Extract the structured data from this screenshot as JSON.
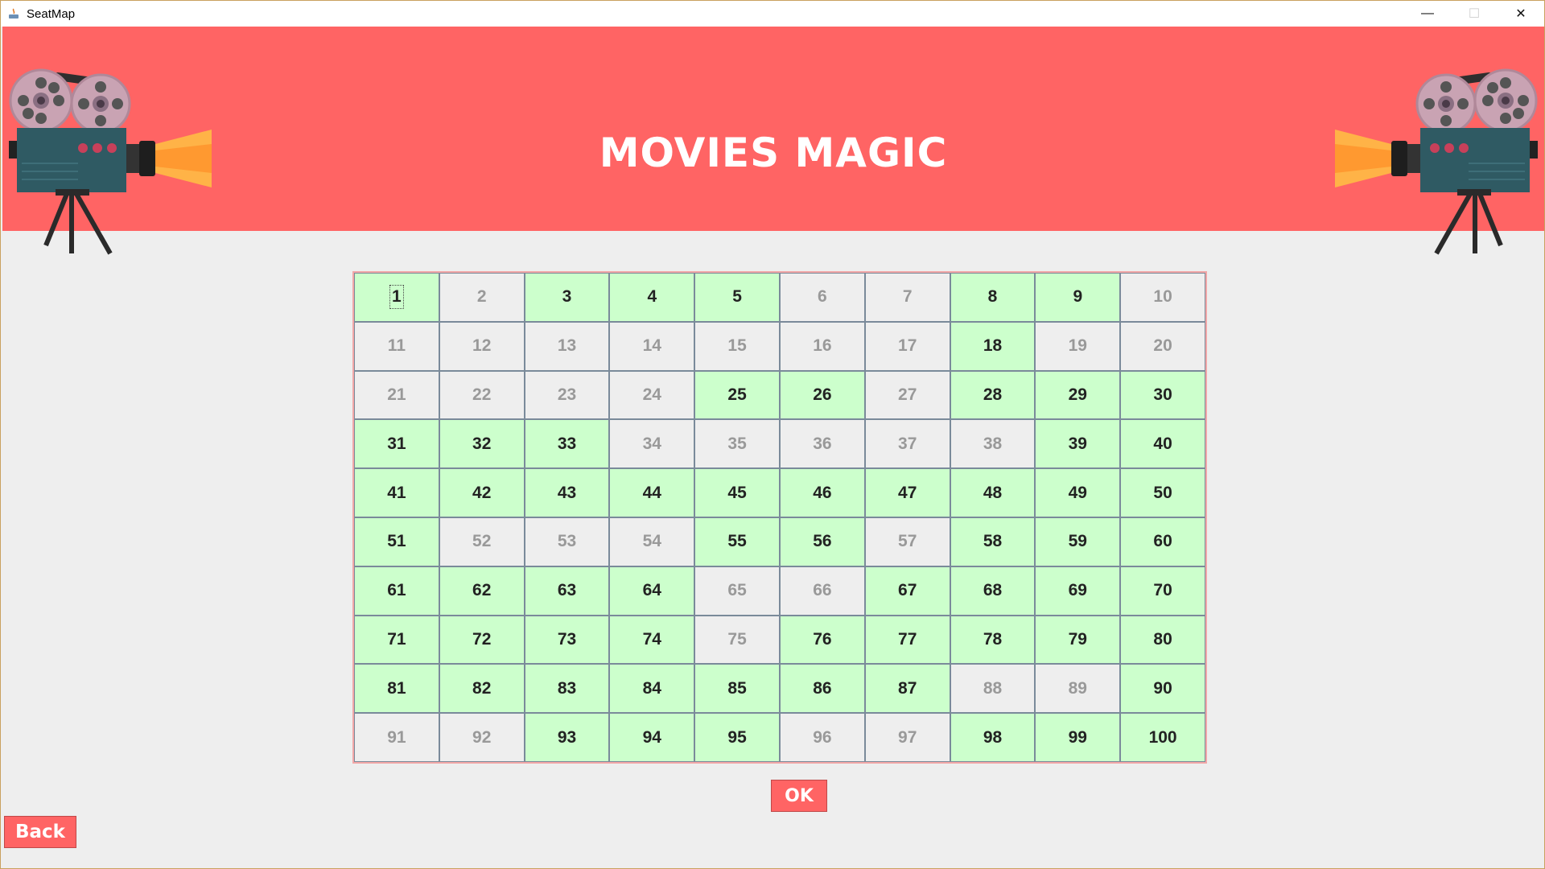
{
  "window": {
    "title": "SeatMap",
    "controls": {
      "minimize": "—",
      "maximize": "☐",
      "close": "✕"
    }
  },
  "banner": {
    "title": "MOVIES MAGIC",
    "background": "#ff6464",
    "left_icon": "movie-projector-icon",
    "right_icon": "movie-projector-icon"
  },
  "seats": {
    "available_color": "#ccffcc",
    "booked_color": "#eeeeee",
    "list": [
      {
        "label": "1",
        "status": "available",
        "focused": true
      },
      {
        "label": "2",
        "status": "booked"
      },
      {
        "label": "3",
        "status": "available"
      },
      {
        "label": "4",
        "status": "available"
      },
      {
        "label": "5",
        "status": "available"
      },
      {
        "label": "6",
        "status": "booked"
      },
      {
        "label": "7",
        "status": "booked"
      },
      {
        "label": "8",
        "status": "available"
      },
      {
        "label": "9",
        "status": "available"
      },
      {
        "label": "10",
        "status": "booked"
      },
      {
        "label": "11",
        "status": "booked"
      },
      {
        "label": "12",
        "status": "booked"
      },
      {
        "label": "13",
        "status": "booked"
      },
      {
        "label": "14",
        "status": "booked"
      },
      {
        "label": "15",
        "status": "booked"
      },
      {
        "label": "16",
        "status": "booked"
      },
      {
        "label": "17",
        "status": "booked"
      },
      {
        "label": "18",
        "status": "available"
      },
      {
        "label": "19",
        "status": "booked"
      },
      {
        "label": "20",
        "status": "booked"
      },
      {
        "label": "21",
        "status": "booked"
      },
      {
        "label": "22",
        "status": "booked"
      },
      {
        "label": "23",
        "status": "booked"
      },
      {
        "label": "24",
        "status": "booked"
      },
      {
        "label": "25",
        "status": "available"
      },
      {
        "label": "26",
        "status": "available"
      },
      {
        "label": "27",
        "status": "booked"
      },
      {
        "label": "28",
        "status": "available"
      },
      {
        "label": "29",
        "status": "available"
      },
      {
        "label": "30",
        "status": "available"
      },
      {
        "label": "31",
        "status": "available"
      },
      {
        "label": "32",
        "status": "available"
      },
      {
        "label": "33",
        "status": "available"
      },
      {
        "label": "34",
        "status": "booked"
      },
      {
        "label": "35",
        "status": "booked"
      },
      {
        "label": "36",
        "status": "booked"
      },
      {
        "label": "37",
        "status": "booked"
      },
      {
        "label": "38",
        "status": "booked"
      },
      {
        "label": "39",
        "status": "available"
      },
      {
        "label": "40",
        "status": "available"
      },
      {
        "label": "41",
        "status": "available"
      },
      {
        "label": "42",
        "status": "available"
      },
      {
        "label": "43",
        "status": "available"
      },
      {
        "label": "44",
        "status": "available"
      },
      {
        "label": "45",
        "status": "available"
      },
      {
        "label": "46",
        "status": "available"
      },
      {
        "label": "47",
        "status": "available"
      },
      {
        "label": "48",
        "status": "available"
      },
      {
        "label": "49",
        "status": "available"
      },
      {
        "label": "50",
        "status": "available"
      },
      {
        "label": "51",
        "status": "available"
      },
      {
        "label": "52",
        "status": "booked"
      },
      {
        "label": "53",
        "status": "booked"
      },
      {
        "label": "54",
        "status": "booked"
      },
      {
        "label": "55",
        "status": "available"
      },
      {
        "label": "56",
        "status": "available"
      },
      {
        "label": "57",
        "status": "booked"
      },
      {
        "label": "58",
        "status": "available"
      },
      {
        "label": "59",
        "status": "available"
      },
      {
        "label": "60",
        "status": "available"
      },
      {
        "label": "61",
        "status": "available"
      },
      {
        "label": "62",
        "status": "available"
      },
      {
        "label": "63",
        "status": "available"
      },
      {
        "label": "64",
        "status": "available"
      },
      {
        "label": "65",
        "status": "booked"
      },
      {
        "label": "66",
        "status": "booked"
      },
      {
        "label": "67",
        "status": "available"
      },
      {
        "label": "68",
        "status": "available"
      },
      {
        "label": "69",
        "status": "available"
      },
      {
        "label": "70",
        "status": "available"
      },
      {
        "label": "71",
        "status": "available"
      },
      {
        "label": "72",
        "status": "available"
      },
      {
        "label": "73",
        "status": "available"
      },
      {
        "label": "74",
        "status": "available"
      },
      {
        "label": "75",
        "status": "booked"
      },
      {
        "label": "76",
        "status": "available"
      },
      {
        "label": "77",
        "status": "available"
      },
      {
        "label": "78",
        "status": "available"
      },
      {
        "label": "79",
        "status": "available"
      },
      {
        "label": "80",
        "status": "available"
      },
      {
        "label": "81",
        "status": "available"
      },
      {
        "label": "82",
        "status": "available"
      },
      {
        "label": "83",
        "status": "available"
      },
      {
        "label": "84",
        "status": "available"
      },
      {
        "label": "85",
        "status": "available"
      },
      {
        "label": "86",
        "status": "available"
      },
      {
        "label": "87",
        "status": "available"
      },
      {
        "label": "88",
        "status": "booked"
      },
      {
        "label": "89",
        "status": "booked"
      },
      {
        "label": "90",
        "status": "available"
      },
      {
        "label": "91",
        "status": "booked"
      },
      {
        "label": "92",
        "status": "booked"
      },
      {
        "label": "93",
        "status": "available"
      },
      {
        "label": "94",
        "status": "available"
      },
      {
        "label": "95",
        "status": "available"
      },
      {
        "label": "96",
        "status": "booked"
      },
      {
        "label": "97",
        "status": "booked"
      },
      {
        "label": "98",
        "status": "available"
      },
      {
        "label": "99",
        "status": "available"
      },
      {
        "label": "100",
        "status": "available"
      }
    ]
  },
  "buttons": {
    "ok_label": "OK",
    "back_label": "Back"
  }
}
